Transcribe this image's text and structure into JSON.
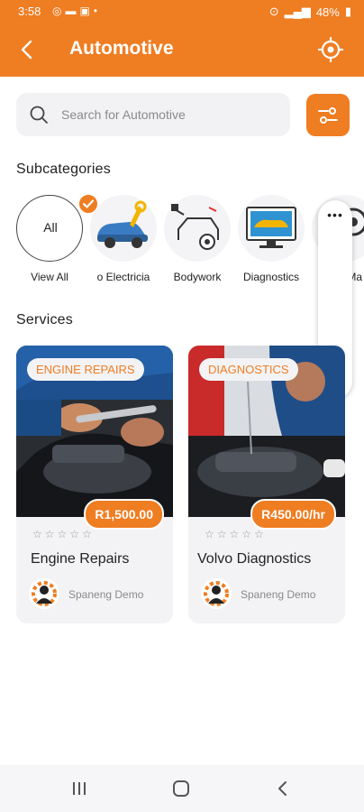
{
  "status_bar": {
    "time": "3:58",
    "battery": "48%",
    "icons": [
      "whatsapp-icon",
      "folder-icon",
      "gallery-icon",
      "dot-icon",
      "hotspot-icon",
      "signal-icon",
      "battery-icon"
    ]
  },
  "header": {
    "title": "Automotive",
    "back_icon": "back-arrow-icon",
    "action_icon": "location-target-icon"
  },
  "search": {
    "placeholder": "Search for Automotive",
    "icon": "search-icon"
  },
  "filter": {
    "icon": "filter-sliders-icon"
  },
  "subcategories": {
    "title": "Subcategories",
    "items": [
      {
        "label": "View All",
        "circle_text": "All",
        "selected": true
      },
      {
        "label": "o Electricia",
        "icon": "auto-electrician-icon"
      },
      {
        "label": "Bodywork",
        "icon": "bodywork-icon"
      },
      {
        "label": "Diagnostics",
        "icon": "diagnostics-icon"
      },
      {
        "label": "g & Ma",
        "icon": "servicing-icon"
      }
    ]
  },
  "services": {
    "title": "Services",
    "items": [
      {
        "badge": "ENGINE REPAIRS",
        "price": "R1,500.00",
        "title": "Engine Repairs",
        "provider": "Spaneng Demo",
        "rating": 0
      },
      {
        "badge": "DIAGNOSTICS",
        "price": "R450.00/hr",
        "title": "Volvo Diagnostics",
        "provider": "Spaneng Demo",
        "rating": 0
      }
    ]
  },
  "colors": {
    "accent": "#ef7d22",
    "card_bg": "#f3f3f5"
  },
  "floating_panel": {
    "icons": [
      "more-icon",
      "music-note-icon"
    ]
  },
  "nav_bar": {
    "icons": [
      "recents-icon",
      "home-icon",
      "back-icon"
    ]
  }
}
